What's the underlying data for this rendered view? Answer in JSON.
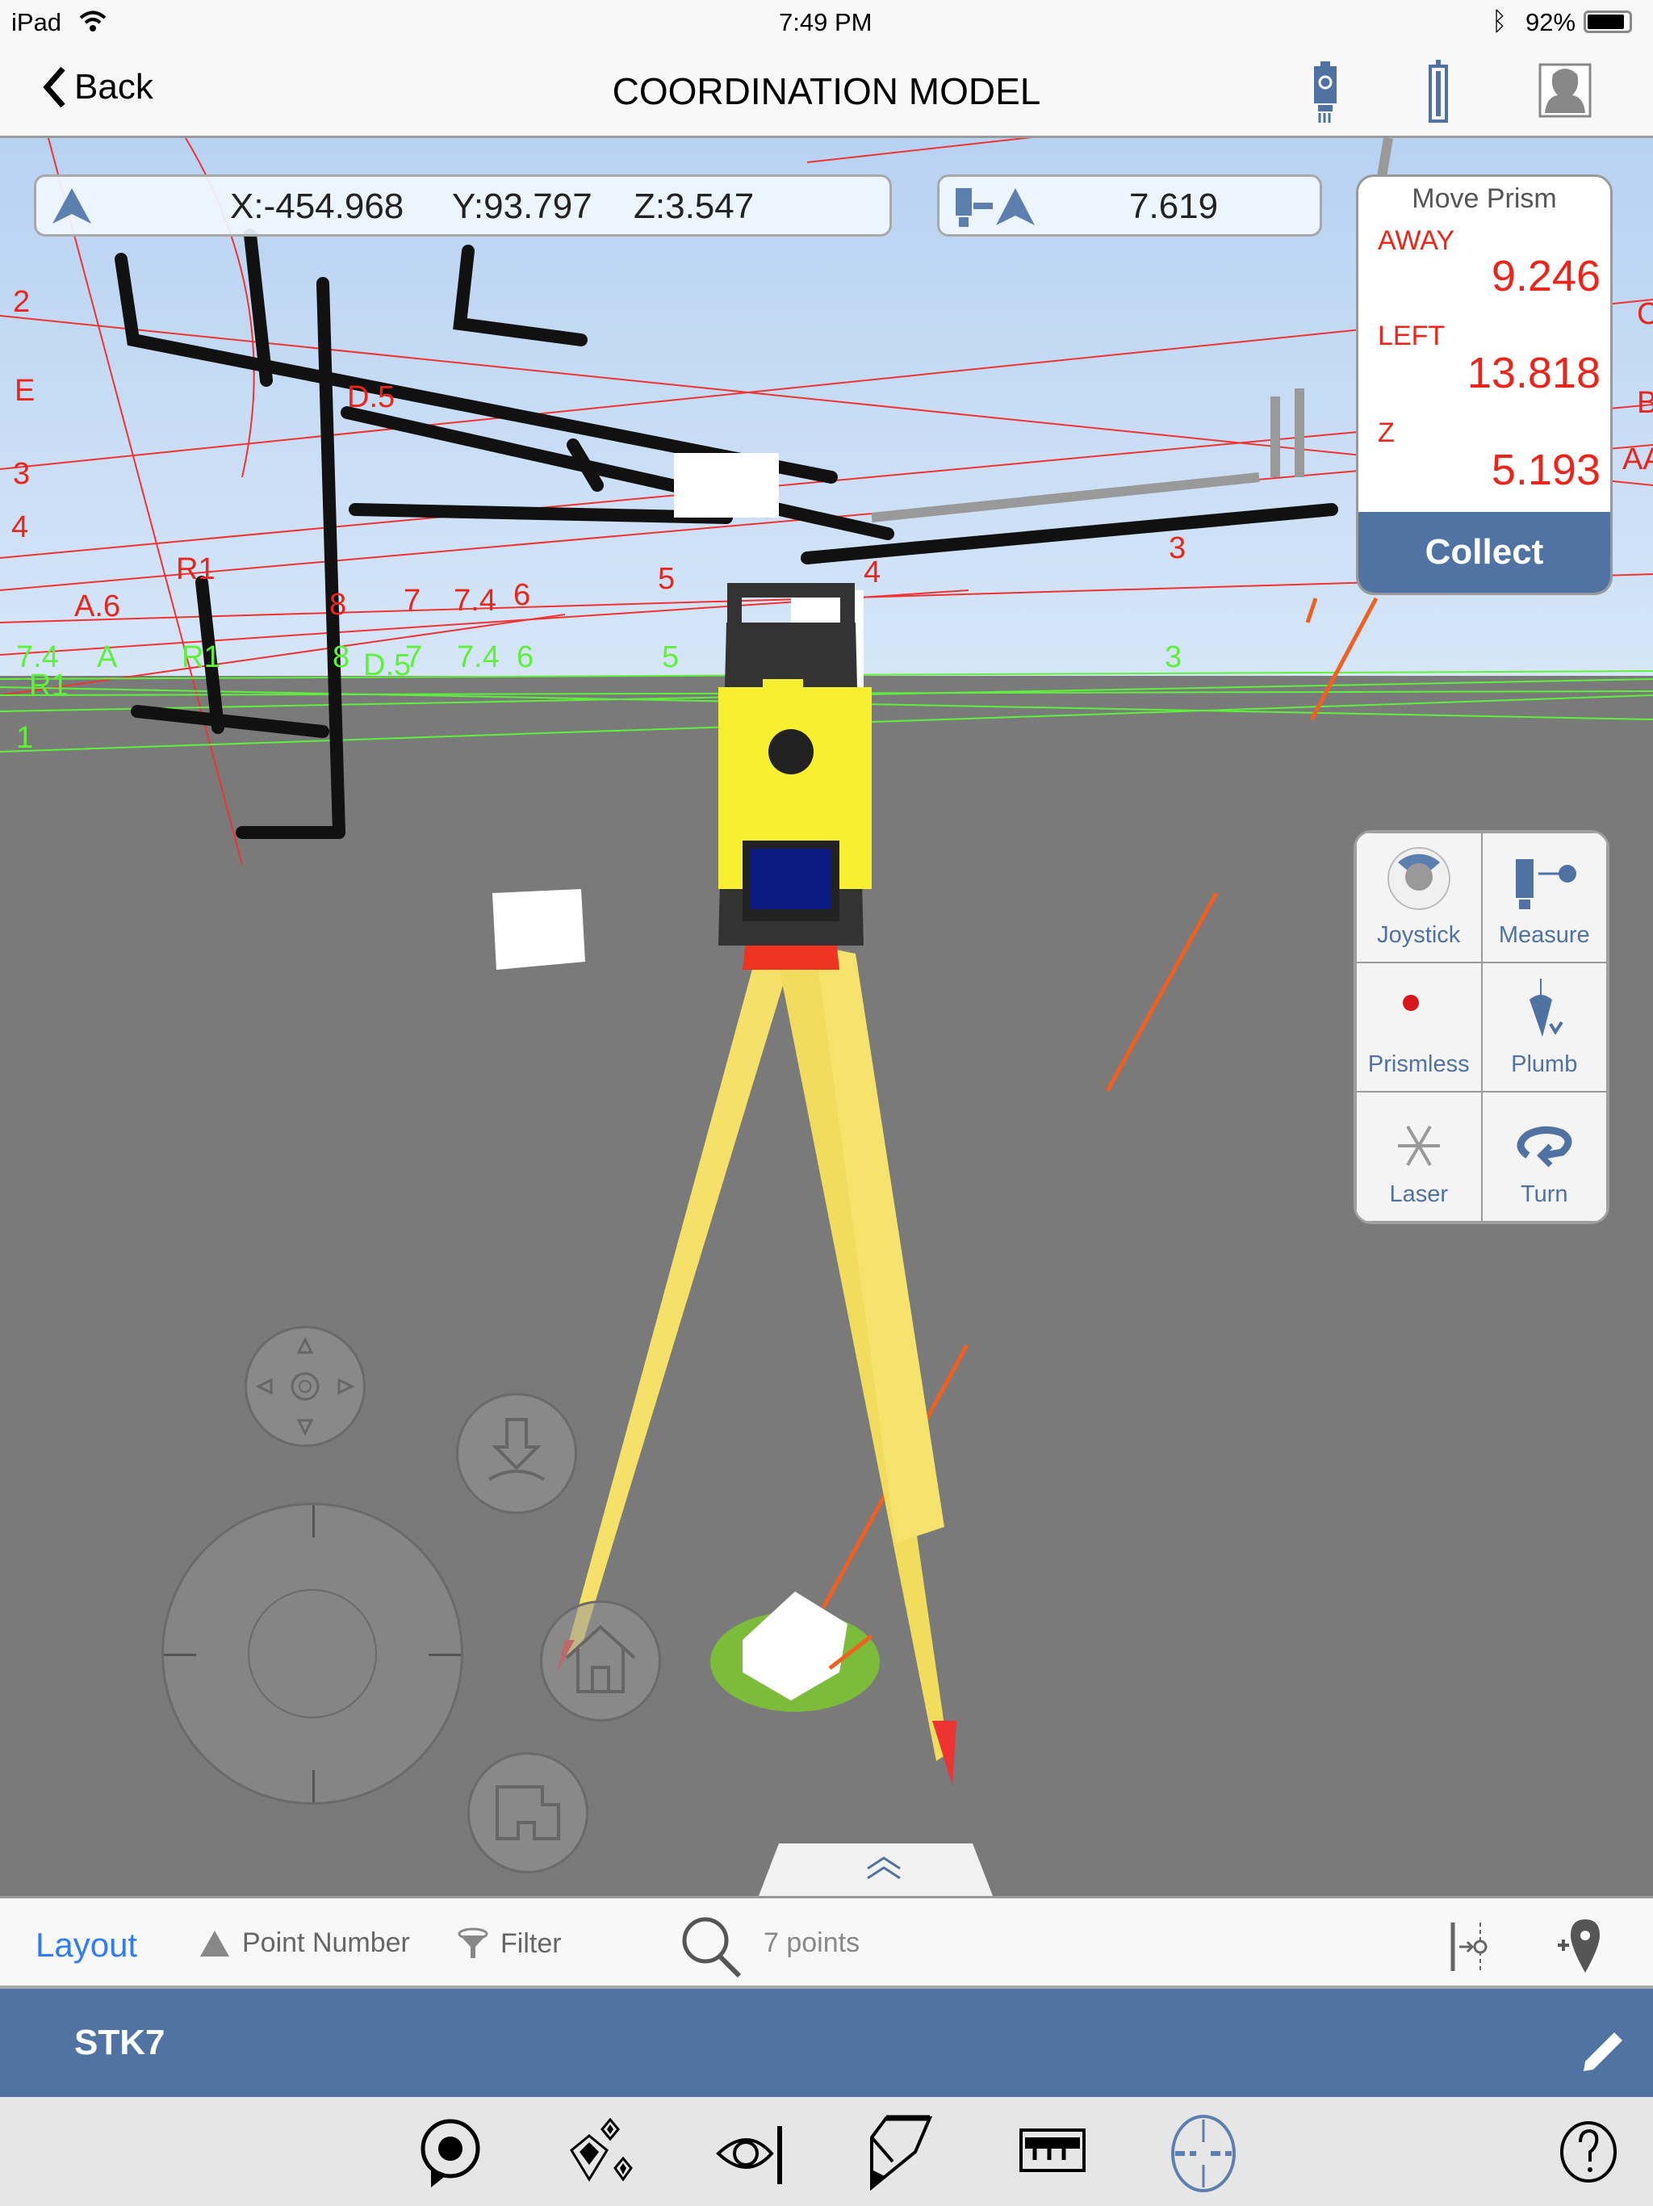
{
  "status_bar": {
    "device": "iPad",
    "time": "7:49 PM",
    "battery": "92%",
    "icons": [
      "wifi-icon",
      "bluetooth-icon",
      "battery-icon"
    ]
  },
  "nav": {
    "back_label": "Back",
    "title": "COORDINATION MODEL",
    "icons": [
      "instrument-icon",
      "prism-pole-icon",
      "user-profile-icon"
    ]
  },
  "coords": {
    "x": "X:-454.968",
    "y": "Y:93.797",
    "z": "Z:3.547"
  },
  "distance": {
    "value": "7.619"
  },
  "move_prism": {
    "title": "Move Prism",
    "away_label": "AWAY",
    "away_value": "9.246",
    "left_label": "LEFT",
    "left_value": "13.818",
    "z_label": "Z",
    "z_value": "5.193",
    "collect_label": "Collect"
  },
  "tools": [
    {
      "label": "Joystick"
    },
    {
      "label": "Measure"
    },
    {
      "label": "Prismless"
    },
    {
      "label": "Plumb"
    },
    {
      "label": "Laser"
    },
    {
      "label": "Turn"
    }
  ],
  "grid_labels": {
    "red": [
      "2",
      "E",
      "D.5",
      "3",
      "4",
      "R1",
      "A.6",
      "8",
      "7",
      "7.4",
      "6",
      "5",
      "4",
      "3",
      "C",
      "B",
      "AA"
    ],
    "green": [
      "7.4",
      "A",
      "R1",
      "8",
      "D.5",
      "7",
      "7.4",
      "6",
      "5",
      "3",
      "1",
      "R1"
    ]
  },
  "toolbar": {
    "layout_label": "Layout",
    "point_number_label": "Point Number",
    "filter_label": "Filter",
    "search_placeholder": "7 points"
  },
  "selected_point": {
    "name": "STK7"
  },
  "colors": {
    "accent": "#4f72a3",
    "link": "#2f7cf6",
    "red_text": "#e8261c",
    "green_grid": "#5ef03a",
    "sky": "#c4daf5",
    "ground": "#7a7a7a"
  }
}
